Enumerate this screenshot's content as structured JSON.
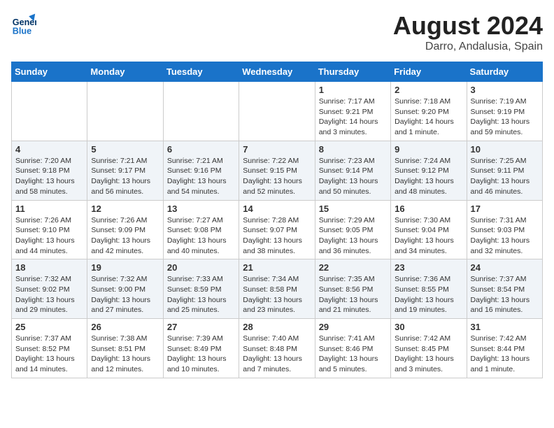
{
  "logo": {
    "line1": "General",
    "line2": "Blue"
  },
  "title": "August 2024",
  "subtitle": "Darro, Andalusia, Spain",
  "days_of_week": [
    "Sunday",
    "Monday",
    "Tuesday",
    "Wednesday",
    "Thursday",
    "Friday",
    "Saturday"
  ],
  "weeks": [
    [
      {
        "day": "",
        "info": ""
      },
      {
        "day": "",
        "info": ""
      },
      {
        "day": "",
        "info": ""
      },
      {
        "day": "",
        "info": ""
      },
      {
        "day": "1",
        "info": "Sunrise: 7:17 AM\nSunset: 9:21 PM\nDaylight: 14 hours\nand 3 minutes."
      },
      {
        "day": "2",
        "info": "Sunrise: 7:18 AM\nSunset: 9:20 PM\nDaylight: 14 hours\nand 1 minute."
      },
      {
        "day": "3",
        "info": "Sunrise: 7:19 AM\nSunset: 9:19 PM\nDaylight: 13 hours\nand 59 minutes."
      }
    ],
    [
      {
        "day": "4",
        "info": "Sunrise: 7:20 AM\nSunset: 9:18 PM\nDaylight: 13 hours\nand 58 minutes."
      },
      {
        "day": "5",
        "info": "Sunrise: 7:21 AM\nSunset: 9:17 PM\nDaylight: 13 hours\nand 56 minutes."
      },
      {
        "day": "6",
        "info": "Sunrise: 7:21 AM\nSunset: 9:16 PM\nDaylight: 13 hours\nand 54 minutes."
      },
      {
        "day": "7",
        "info": "Sunrise: 7:22 AM\nSunset: 9:15 PM\nDaylight: 13 hours\nand 52 minutes."
      },
      {
        "day": "8",
        "info": "Sunrise: 7:23 AM\nSunset: 9:14 PM\nDaylight: 13 hours\nand 50 minutes."
      },
      {
        "day": "9",
        "info": "Sunrise: 7:24 AM\nSunset: 9:12 PM\nDaylight: 13 hours\nand 48 minutes."
      },
      {
        "day": "10",
        "info": "Sunrise: 7:25 AM\nSunset: 9:11 PM\nDaylight: 13 hours\nand 46 minutes."
      }
    ],
    [
      {
        "day": "11",
        "info": "Sunrise: 7:26 AM\nSunset: 9:10 PM\nDaylight: 13 hours\nand 44 minutes."
      },
      {
        "day": "12",
        "info": "Sunrise: 7:26 AM\nSunset: 9:09 PM\nDaylight: 13 hours\nand 42 minutes."
      },
      {
        "day": "13",
        "info": "Sunrise: 7:27 AM\nSunset: 9:08 PM\nDaylight: 13 hours\nand 40 minutes."
      },
      {
        "day": "14",
        "info": "Sunrise: 7:28 AM\nSunset: 9:07 PM\nDaylight: 13 hours\nand 38 minutes."
      },
      {
        "day": "15",
        "info": "Sunrise: 7:29 AM\nSunset: 9:05 PM\nDaylight: 13 hours\nand 36 minutes."
      },
      {
        "day": "16",
        "info": "Sunrise: 7:30 AM\nSunset: 9:04 PM\nDaylight: 13 hours\nand 34 minutes."
      },
      {
        "day": "17",
        "info": "Sunrise: 7:31 AM\nSunset: 9:03 PM\nDaylight: 13 hours\nand 32 minutes."
      }
    ],
    [
      {
        "day": "18",
        "info": "Sunrise: 7:32 AM\nSunset: 9:02 PM\nDaylight: 13 hours\nand 29 minutes."
      },
      {
        "day": "19",
        "info": "Sunrise: 7:32 AM\nSunset: 9:00 PM\nDaylight: 13 hours\nand 27 minutes."
      },
      {
        "day": "20",
        "info": "Sunrise: 7:33 AM\nSunset: 8:59 PM\nDaylight: 13 hours\nand 25 minutes."
      },
      {
        "day": "21",
        "info": "Sunrise: 7:34 AM\nSunset: 8:58 PM\nDaylight: 13 hours\nand 23 minutes."
      },
      {
        "day": "22",
        "info": "Sunrise: 7:35 AM\nSunset: 8:56 PM\nDaylight: 13 hours\nand 21 minutes."
      },
      {
        "day": "23",
        "info": "Sunrise: 7:36 AM\nSunset: 8:55 PM\nDaylight: 13 hours\nand 19 minutes."
      },
      {
        "day": "24",
        "info": "Sunrise: 7:37 AM\nSunset: 8:54 PM\nDaylight: 13 hours\nand 16 minutes."
      }
    ],
    [
      {
        "day": "25",
        "info": "Sunrise: 7:37 AM\nSunset: 8:52 PM\nDaylight: 13 hours\nand 14 minutes."
      },
      {
        "day": "26",
        "info": "Sunrise: 7:38 AM\nSunset: 8:51 PM\nDaylight: 13 hours\nand 12 minutes."
      },
      {
        "day": "27",
        "info": "Sunrise: 7:39 AM\nSunset: 8:49 PM\nDaylight: 13 hours\nand 10 minutes."
      },
      {
        "day": "28",
        "info": "Sunrise: 7:40 AM\nSunset: 8:48 PM\nDaylight: 13 hours\nand 7 minutes."
      },
      {
        "day": "29",
        "info": "Sunrise: 7:41 AM\nSunset: 8:46 PM\nDaylight: 13 hours\nand 5 minutes."
      },
      {
        "day": "30",
        "info": "Sunrise: 7:42 AM\nSunset: 8:45 PM\nDaylight: 13 hours\nand 3 minutes."
      },
      {
        "day": "31",
        "info": "Sunrise: 7:42 AM\nSunset: 8:44 PM\nDaylight: 13 hours\nand 1 minute."
      }
    ]
  ]
}
